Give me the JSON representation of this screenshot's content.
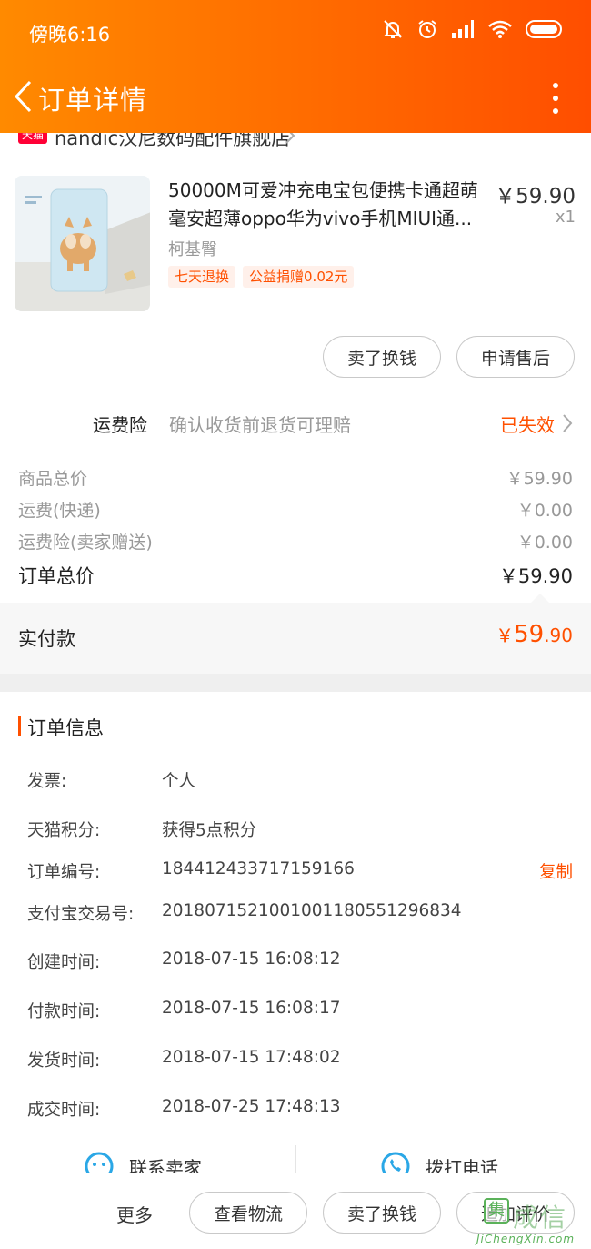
{
  "status_bar": {
    "time": "傍晚6:16"
  },
  "nav": {
    "title": "订单详情"
  },
  "shop": {
    "badge": "天猫",
    "name": "nandic汉尼数码配件旗舰店"
  },
  "product": {
    "title_line1": "50000M可爱冲充电宝包便携卡通超萌",
    "title_line2": "毫安超薄oppo华为vivo手机MIUI通...",
    "price": "￥59.90",
    "quantity": "x1",
    "sku": "柯基臀",
    "tags": [
      "七天退换",
      "公益捐赠0.02元"
    ],
    "image_caption": "柯基臀"
  },
  "product_actions": {
    "sell_label": "卖了换钱",
    "after_sale_label": "申请售后"
  },
  "shipping_insurance": {
    "label": "运费险",
    "description": "确认收货前退货可理赔",
    "status": "已失效"
  },
  "price_summary": {
    "goods_total_label": "商品总价",
    "goods_total_value": "￥59.90",
    "shipping_label": "运费(快递)",
    "shipping_value": "￥0.00",
    "insurance_label": "运费险(卖家赠送)",
    "insurance_value": "￥0.00",
    "order_total_label": "订单总价",
    "order_total_value": "￥59.90"
  },
  "paid": {
    "label": "实付款",
    "currency": "￥",
    "integer": "59",
    "decimal": ".90"
  },
  "order_info": {
    "title": "订单信息",
    "rows": [
      {
        "label": "发票:",
        "value": "个人"
      },
      {
        "label": "天猫积分:",
        "value": "获得5点积分"
      },
      {
        "label": "订单编号:",
        "value": "184412433717159166"
      },
      {
        "label": "支付宝交易号:",
        "value": "2018071521001001180551296834"
      },
      {
        "label": "创建时间:",
        "value": "2018-07-15 16:08:12"
      },
      {
        "label": "付款时间:",
        "value": "2018-07-15 16:08:17"
      },
      {
        "label": "发货时间:",
        "value": "2018-07-15 17:48:02"
      },
      {
        "label": "成交时间:",
        "value": "2018-07-25 17:48:13"
      }
    ],
    "copy_label": "复制"
  },
  "contact": {
    "seller_label": "联系卖家",
    "phone_label": "拨打电话"
  },
  "bottom_bar": {
    "more_label": "更多",
    "logistics_label": "查看物流",
    "sell_label": "卖了换钱",
    "review_label": "追加评价"
  },
  "watermark": {
    "logo_char": "集",
    "text": "成信",
    "url": "JiChengXin.com"
  },
  "colors": {
    "accent": "#ff5000",
    "header_start": "#ff8a00",
    "header_end": "#ff4e00"
  }
}
